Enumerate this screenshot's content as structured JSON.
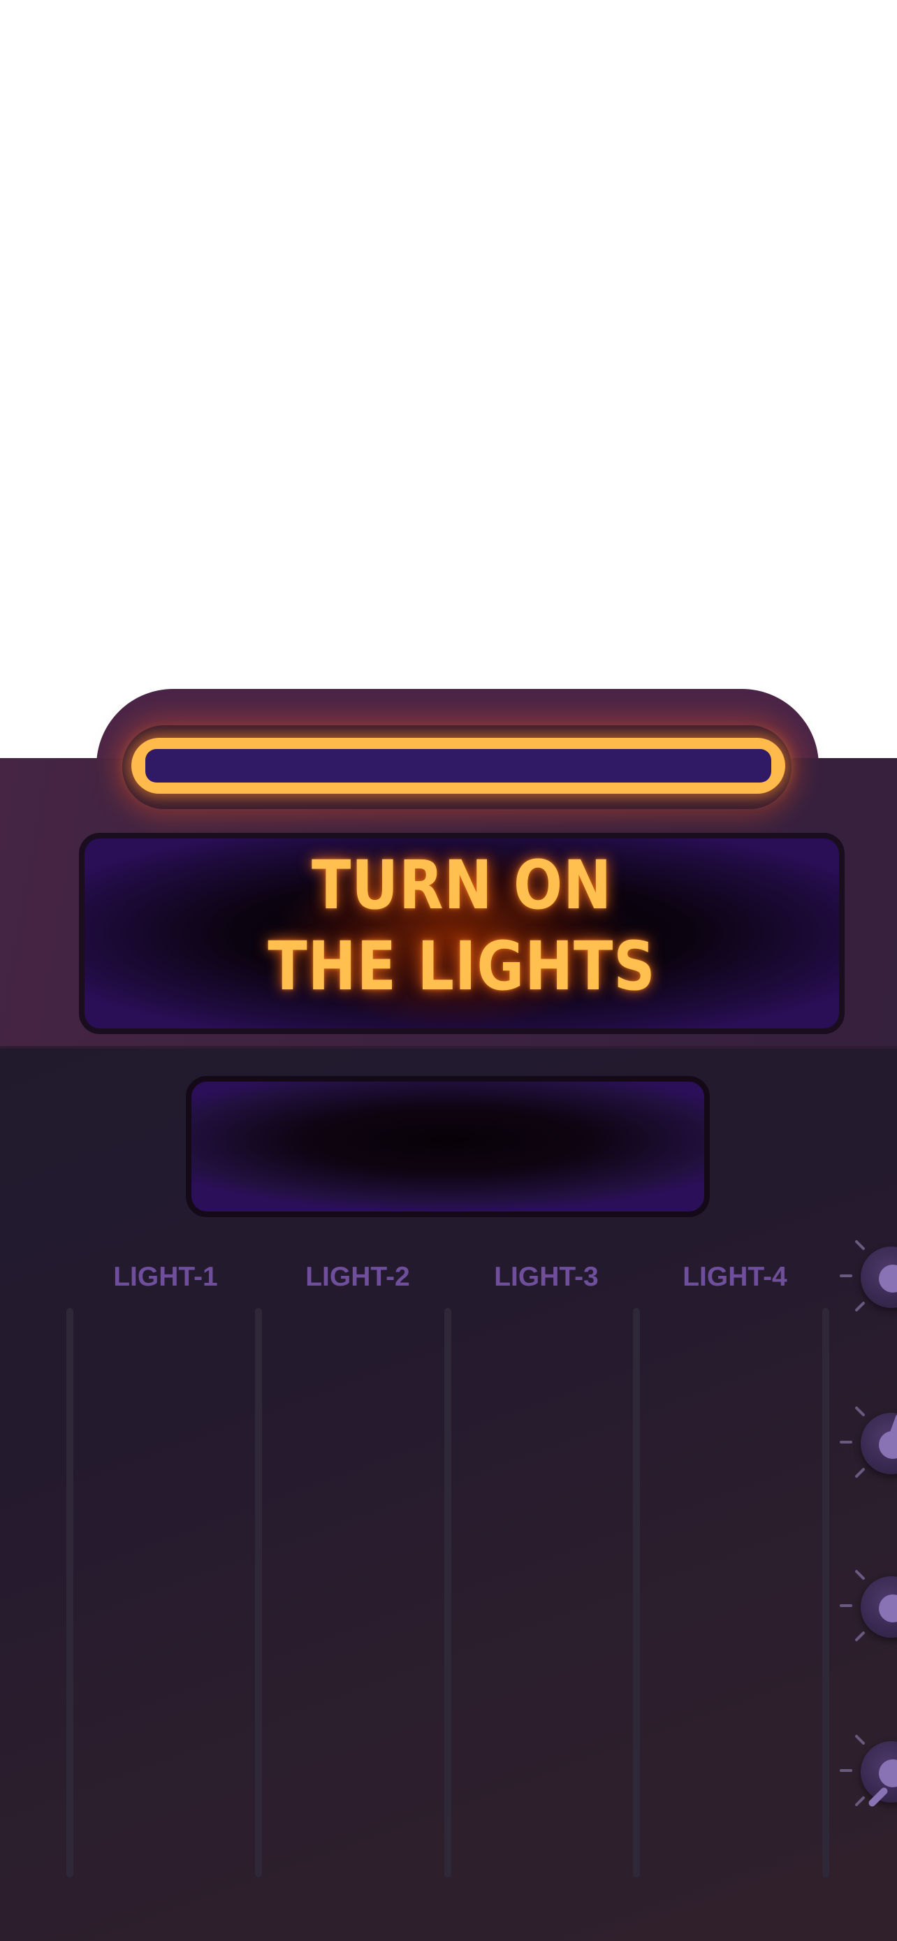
{
  "game": {
    "title_line_1": "TURN ON",
    "title_line_2": "THE LIGHTS",
    "progress": 0,
    "sub_display_text": ""
  },
  "lights": [
    {
      "label": "LIGHT-1"
    },
    {
      "label": "LIGHT-2"
    },
    {
      "label": "LIGHT-3"
    },
    {
      "label": "LIGHT-4"
    }
  ],
  "knobs": [
    {
      "name": "knob-1"
    },
    {
      "name": "knob-2"
    },
    {
      "name": "knob-3"
    },
    {
      "name": "knob-4"
    }
  ],
  "colors": {
    "accent": "#ffba4c",
    "panel": "#241a2e",
    "header": "#4a2547",
    "screen": "#2a0e56",
    "label": "#6f4f9c"
  }
}
